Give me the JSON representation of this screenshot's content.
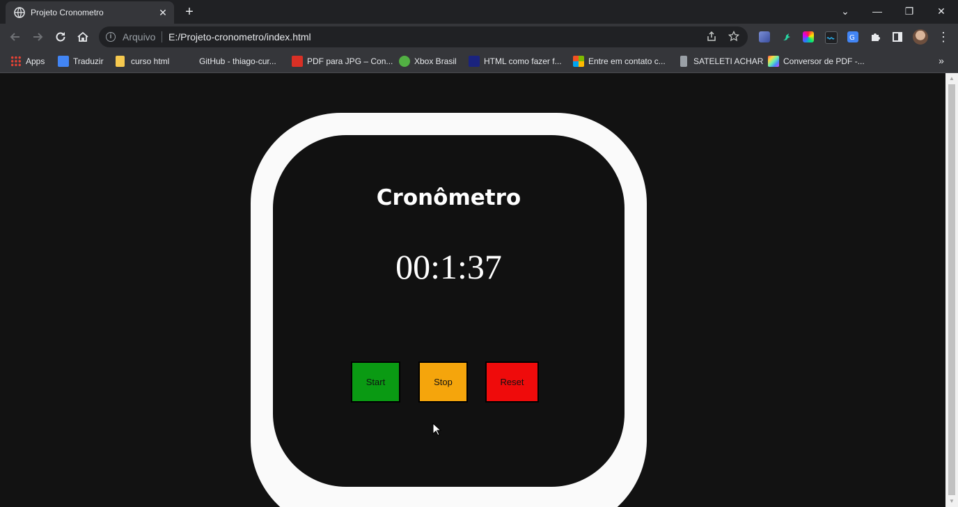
{
  "browser": {
    "tab": {
      "title": "Projeto Cronometro",
      "favicon": "globe-icon"
    },
    "window_controls": {
      "collapse": "⌄",
      "minimize": "—",
      "restore": "❐",
      "close": "✕"
    },
    "new_tab_symbol": "+",
    "close_tab_symbol": "✕",
    "omnibox": {
      "scheme_label": "Arquivo",
      "url": "E:/Projeto-cronometro/index.html"
    },
    "bookmarks": [
      {
        "label": "Apps",
        "icon": "apps-grid-icon",
        "color": "#ea4335"
      },
      {
        "label": "Traduzir",
        "icon": "google-translate-icon",
        "color": "#4285f4"
      },
      {
        "label": "curso html",
        "icon": "folder-icon",
        "color": "#f6c94f"
      },
      {
        "label": "GitHub - thiago-cur...",
        "icon": "github-icon",
        "color": "#35363a"
      },
      {
        "label": "PDF para JPG – Con...",
        "icon": "pdf-icon",
        "color": "#d93025"
      },
      {
        "label": "Xbox Brasil",
        "icon": "xbox-icon",
        "color": "#52b043"
      },
      {
        "label": "HTML como fazer f...",
        "icon": "hr-icon",
        "color": "#1a237e"
      },
      {
        "label": "Entre em contato c...",
        "icon": "microsoft-icon",
        "color": "#f25022"
      },
      {
        "label": "SATELETI ACHAR",
        "icon": "shield-icon",
        "color": "#9aa0a6"
      },
      {
        "label": "Conversor de PDF -...",
        "icon": "converter-icon",
        "color": "#a142f4"
      }
    ],
    "bookmarks_more": "»"
  },
  "page": {
    "title": "Cronômetro",
    "time": "00:1:37",
    "buttons": [
      {
        "label": "Start",
        "color": "#0a9a13"
      },
      {
        "label": "Stop",
        "color": "#f5a50c"
      },
      {
        "label": "Reset",
        "color": "#ef0b0b"
      }
    ]
  }
}
